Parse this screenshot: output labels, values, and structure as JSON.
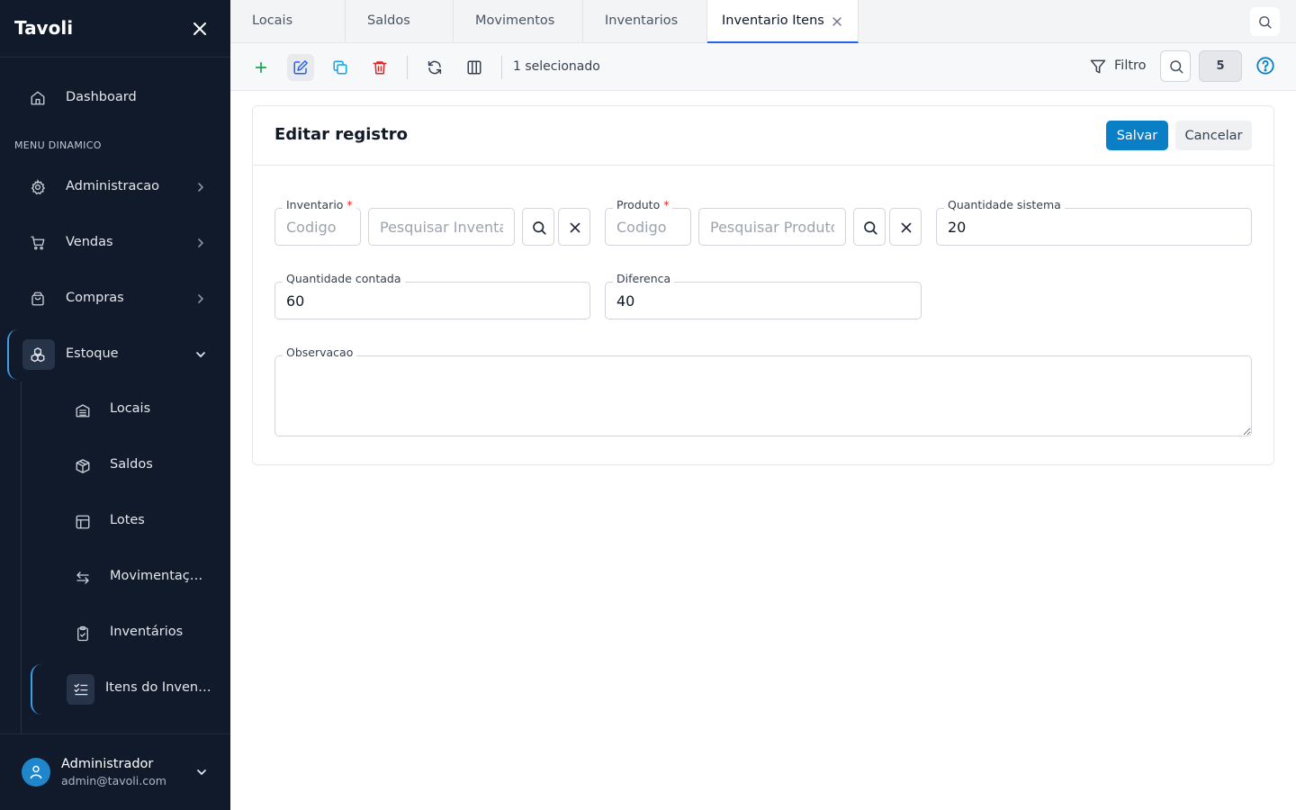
{
  "app": {
    "brand": "Tavoli"
  },
  "sidebar": {
    "dashboard": "Dashboard",
    "section_label": "MENU DINAMICO",
    "items": [
      {
        "label": "Administracao",
        "icon": "gear-icon"
      },
      {
        "label": "Vendas",
        "icon": "cart-icon"
      },
      {
        "label": "Compras",
        "icon": "bag-icon"
      },
      {
        "label": "Estoque",
        "icon": "boxes-icon",
        "expanded": true
      }
    ],
    "sub_items": [
      {
        "label": "Locais",
        "icon": "warehouse-icon"
      },
      {
        "label": "Saldos",
        "icon": "package-icon"
      },
      {
        "label": "Lotes",
        "icon": "layout-icon"
      },
      {
        "label": "Movimentações",
        "icon": "arrows-icon"
      },
      {
        "label": "Inventários",
        "icon": "clipboard-check-icon"
      },
      {
        "label": "Itens do Inventário",
        "icon": "list-checks-icon",
        "active": true
      }
    ],
    "user": {
      "name": "Administrador",
      "email": "admin@tavoli.com"
    }
  },
  "tabs": [
    "Locais",
    "Saldos",
    "Movimentos",
    "Inventarios",
    "Inventario Itens"
  ],
  "active_tab": "Inventario Itens",
  "toolbar": {
    "selected_text": "1 selecionado",
    "filter_label": "Filtro",
    "count": "5"
  },
  "form": {
    "title": "Editar registro",
    "save_label": "Salvar",
    "cancel_label": "Cancelar",
    "inventario": {
      "label": "Inventario",
      "code_placeholder": "Codigo",
      "search_placeholder": "Pesquisar Inventario"
    },
    "produto": {
      "label": "Produto",
      "code_placeholder": "Codigo",
      "search_placeholder": "Pesquisar Produto"
    },
    "required_mark": "*",
    "quantidade_sistema": {
      "label": "Quantidade sistema",
      "value": "20"
    },
    "quantidade_contada": {
      "label": "Quantidade contada",
      "value": "60"
    },
    "diferenca": {
      "label": "Diferenca",
      "value": "40"
    },
    "observacao": {
      "label": "Observacao",
      "value": ""
    }
  },
  "colors": {
    "sidebar_bg": "#111a2b",
    "accent": "#0a7fc6",
    "active_indicator": "#3aa0e8",
    "delete": "#dc2626",
    "add": "#16a34a",
    "edit": "#2563eb"
  }
}
